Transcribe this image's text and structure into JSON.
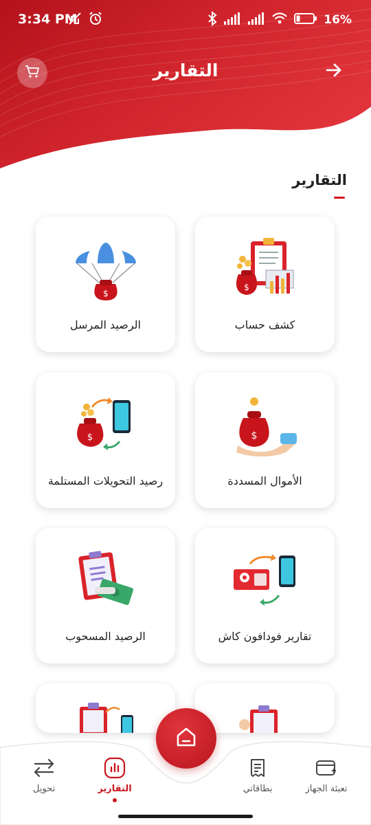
{
  "status_bar": {
    "time": "3:34 PM",
    "battery": "16%"
  },
  "header": {
    "title": "التقارير"
  },
  "section": {
    "title": "التقارير"
  },
  "cards": [
    {
      "label": "كشف حساب"
    },
    {
      "label": "الرصيد المرسل"
    },
    {
      "label": "الأموال المسددة"
    },
    {
      "label": "رصيد التحويلات المستلمة"
    },
    {
      "label": "تقارير فودافون كاش"
    },
    {
      "label": "الرصيد المسحوب"
    }
  ],
  "bottom_nav": {
    "items": [
      {
        "label": "تعبئة الجهاز"
      },
      {
        "label": "بطاقاتي"
      },
      {
        "label": "التقارير"
      },
      {
        "label": "تحويل"
      }
    ]
  },
  "colors": {
    "brand_red": "#d3151c",
    "header_red": "#c81f27"
  },
  "icons": [
    "cart-icon",
    "arrow-right-icon",
    "home-icon",
    "card-topup-icon",
    "receipt-icon",
    "reports-icon",
    "transfer-icon"
  ]
}
